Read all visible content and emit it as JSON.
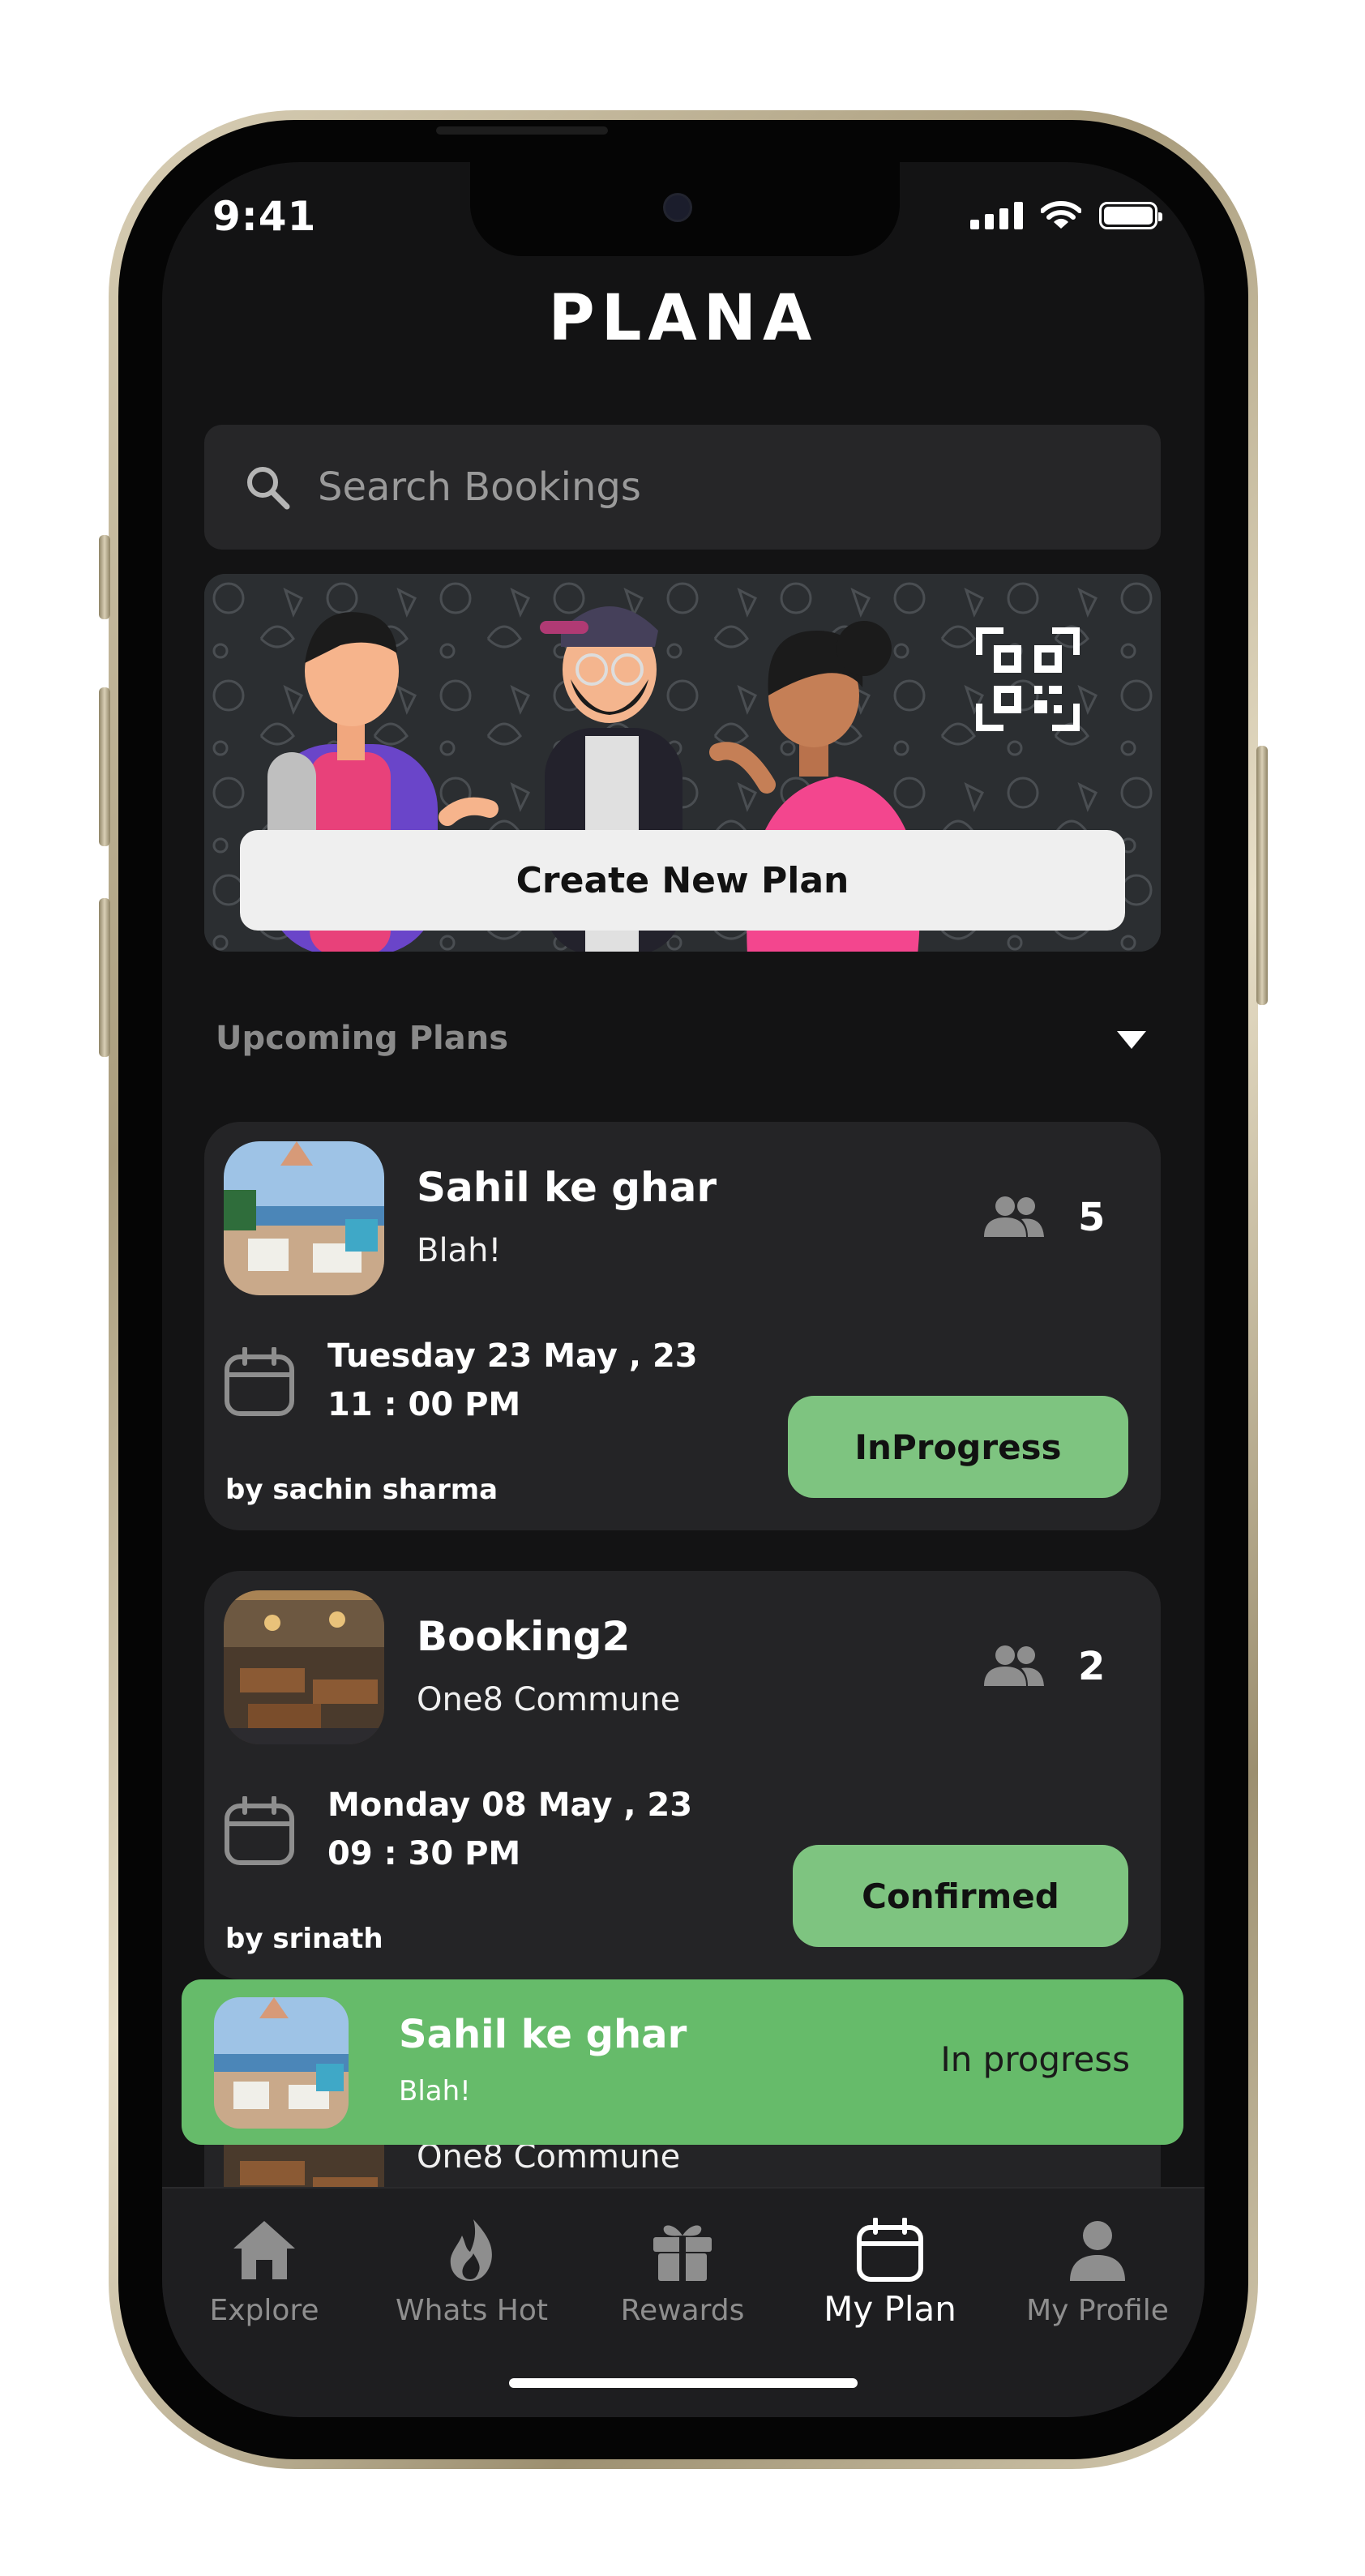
{
  "status_bar": {
    "time": "9:41"
  },
  "header": {
    "logo": "PLANA"
  },
  "search": {
    "placeholder": "Search Bookings"
  },
  "banner": {
    "button_label": "Create New Plan"
  },
  "section": {
    "title": "Upcoming Plans"
  },
  "cards": [
    {
      "title": "Sahil ke ghar",
      "subtitle": "Blah!",
      "people": "5",
      "date": "Tuesday 23 May , 23",
      "time": "11 : 00  PM",
      "author": "by sachin sharma",
      "status": "InProgress"
    },
    {
      "title": "Booking2",
      "subtitle": "One8 Commune",
      "people": "2",
      "date": "Monday 08 May , 23",
      "time": "09 : 30  PM",
      "author": "by srinath",
      "status": "Confirmed"
    },
    {
      "subtitle": "One8 Commune"
    }
  ],
  "toast": {
    "title": "Sahil ke ghar",
    "subtitle": "Blah!",
    "status": "In progress"
  },
  "tabbar": {
    "tabs": [
      {
        "label": "Explore",
        "icon": "home-icon"
      },
      {
        "label": "Whats Hot",
        "icon": "flame-icon"
      },
      {
        "label": "Rewards",
        "icon": "gift-icon"
      },
      {
        "label": "My Plan",
        "icon": "calendar-icon",
        "active": true
      },
      {
        "label": "My Profile",
        "icon": "person-icon"
      }
    ]
  },
  "colors": {
    "background": "#131314",
    "card": "#242426",
    "status_green": "#7ec480",
    "toast_green": "#66bb6a"
  }
}
